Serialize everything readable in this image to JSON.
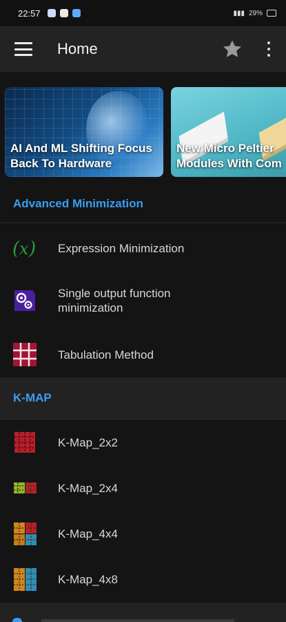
{
  "status_bar": {
    "time": "22:57",
    "battery": "29%"
  },
  "app_bar": {
    "title": "Home",
    "icons": [
      "menu-icon",
      "star-icon",
      "more-vert-icon"
    ]
  },
  "carousel": {
    "cards": [
      {
        "title_line1": "AI And ML Shifting Focus",
        "title_line2": "Back To Hardware"
      },
      {
        "title_line1": "New Micro Peltier",
        "title_line2": "Modules With Com"
      }
    ]
  },
  "sections": [
    {
      "header": "Advanced Minimization",
      "items": [
        {
          "label": "Expression Minimization",
          "icon": "function-x-icon"
        },
        {
          "label_line1": "Single output function",
          "label_line2": "minimization",
          "icon": "gears-icon"
        },
        {
          "label": "Tabulation Method",
          "icon": "grid-table-icon"
        }
      ]
    },
    {
      "header": "K-MAP",
      "items": [
        {
          "label": "K-Map_2x2",
          "icon": "kmap-2x2-icon"
        },
        {
          "label": "K-Map_2x4",
          "icon": "kmap-2x4-icon"
        },
        {
          "label": "K-Map_4x4",
          "icon": "kmap-4x4-icon"
        },
        {
          "label": "K-Map_4x8",
          "icon": "kmap-4x8-icon"
        }
      ]
    }
  ],
  "colors": {
    "accent": "#3b9ef0",
    "background": "#141414",
    "appbar": "#232323"
  }
}
